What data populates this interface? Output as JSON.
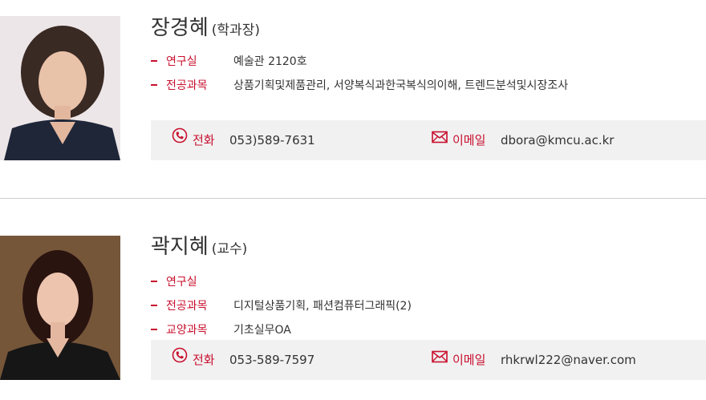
{
  "faculty": [
    {
      "name": "장경혜",
      "title": "(학과장)",
      "info": [
        {
          "label": "연구실",
          "value": "예술관 2120호"
        },
        {
          "label": "전공과목",
          "value": "상품기획및제품관리, 서양복식과한국복식의이해, 트렌드분석및시장조사"
        }
      ],
      "phone_label": "전화",
      "phone": "053)589-7631",
      "email_label": "이메일",
      "email": "dbora@kmcu.ac.kr"
    },
    {
      "name": "곽지혜",
      "title": "(교수)",
      "info": [
        {
          "label": "연구실",
          "value": ""
        },
        {
          "label": "전공과목",
          "value": "디지털상품기획, 패션컴퓨터그래픽(2)"
        },
        {
          "label": "교양과목",
          "value": "기초실무OA"
        }
      ],
      "phone_label": "전화",
      "phone": "053-589-7597",
      "email_label": "이메일",
      "email": "rhkrwl222@naver.com"
    }
  ],
  "colors": {
    "accent": "#c8102e",
    "contact_bg": "#f1f1f1",
    "divider": "#cfcfcf"
  },
  "icons": {
    "phone": "phone-icon",
    "email": "envelope-icon"
  }
}
